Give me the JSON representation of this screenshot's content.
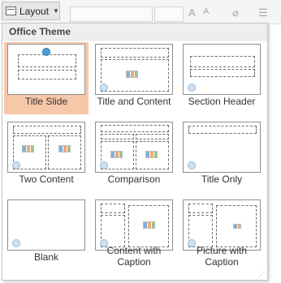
{
  "ribbon": {
    "layout_button_label": "Layout"
  },
  "gallery": {
    "section_title": "Office Theme",
    "layouts": [
      {
        "label": "Title Slide",
        "selected": true
      },
      {
        "label": "Title and Content",
        "selected": false
      },
      {
        "label": "Section Header",
        "selected": false
      },
      {
        "label": "Two Content",
        "selected": false
      },
      {
        "label": "Comparison",
        "selected": false
      },
      {
        "label": "Title Only",
        "selected": false
      },
      {
        "label": "Blank",
        "selected": false
      },
      {
        "label": "Content with\nCaption",
        "selected": false
      },
      {
        "label": "Picture with\nCaption",
        "selected": false
      }
    ]
  },
  "colors": {
    "selected_tile": "#f7c7a9",
    "header_bg": "#eeeeee"
  }
}
